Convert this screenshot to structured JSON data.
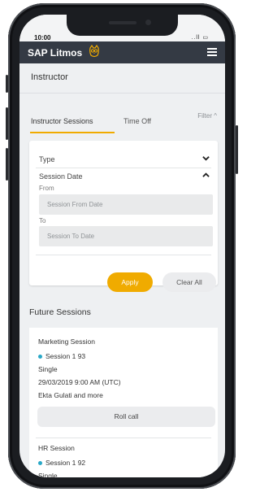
{
  "status_bar": {
    "time": "10:00",
    "signal": "..ll ▭"
  },
  "app": {
    "brand": "SAP Litmos",
    "owl_icon": "owl-icon",
    "menu_icon": "hamburger-menu-icon"
  },
  "page": {
    "title": "Instructor"
  },
  "tabs": [
    {
      "label": "Instructor Sessions",
      "active": true
    },
    {
      "label": "Time Off",
      "active": false
    }
  ],
  "filter": {
    "toggle_label": "Filter ^",
    "type_label": "Type",
    "session_date_label": "Session Date",
    "from_label": "From",
    "from_placeholder": "Session From Date",
    "to_label": "To",
    "to_placeholder": "Session To Date",
    "apply_label": "Apply",
    "clear_label": "Clear All"
  },
  "future_sessions": {
    "heading": "Future Sessions",
    "items": [
      {
        "title": "Marketing Session",
        "session": "Session 1 93",
        "type": "Single",
        "datetime": "29/03/2019 9:00 AM (UTC)",
        "instructors": "Ekta Gulati and more",
        "action": "Roll call"
      },
      {
        "title": "HR Session",
        "session": "Session 1 92",
        "type": "Single"
      }
    ]
  },
  "colors": {
    "accent": "#f0ab00",
    "appbar": "#343a44",
    "dot": "#29a8c7"
  }
}
